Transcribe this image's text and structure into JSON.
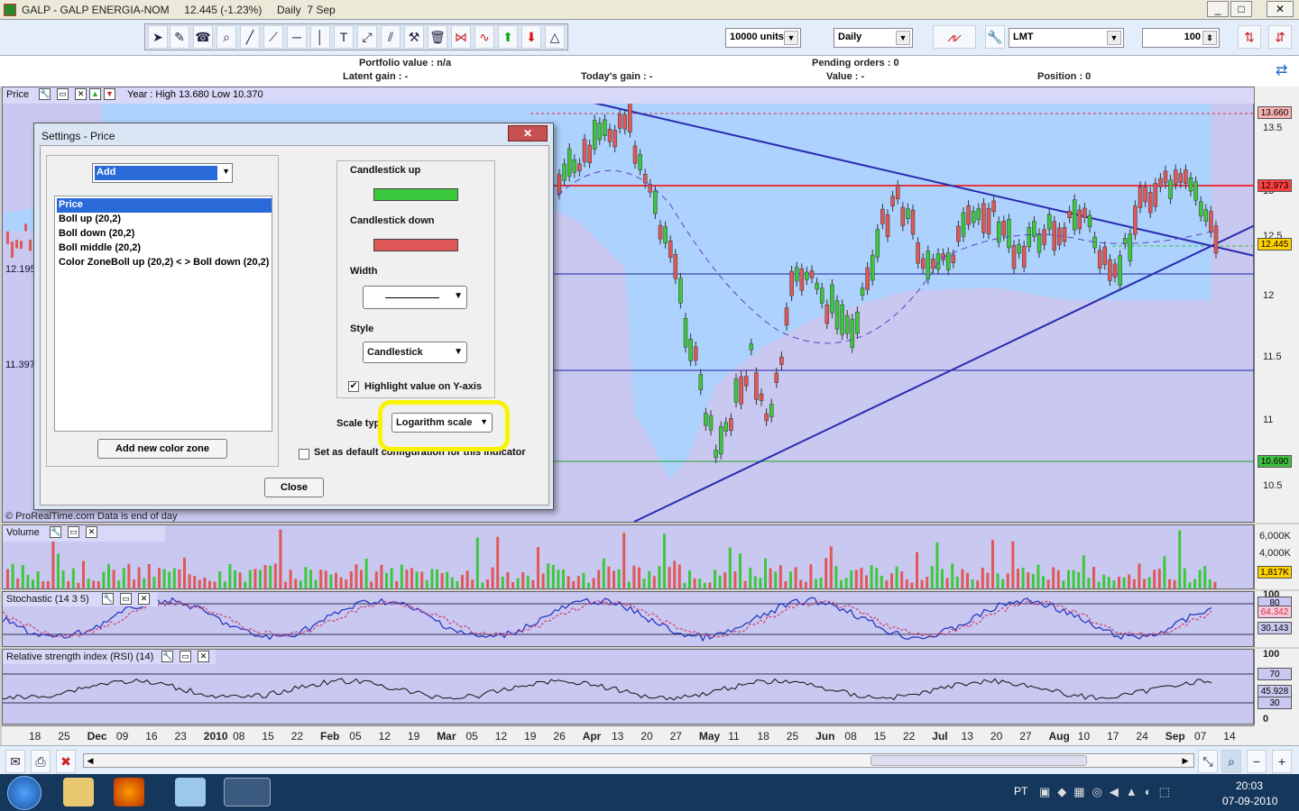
{
  "window": {
    "title": "GALP - GALP ENERGIA-NOM     12.445 (-1.23%)     Daily  7 Sep",
    "min": "_",
    "max": "□",
    "close": "✕"
  },
  "toolbar": {
    "units": "10000 units",
    "period": "Daily",
    "order_type": "LMT",
    "quantity": "100"
  },
  "portfolio": {
    "value": "Portfolio value : n/a",
    "latent": "Latent gain : -",
    "today": "Today's gain : -",
    "pending": "Pending orders : 0",
    "value2": "Value : -",
    "position": "Position : 0"
  },
  "price_panel": {
    "title": "Price",
    "year_info": "Year : High 13.680 Low 10.370",
    "left_val1": "12.195",
    "left_val2": "11.397",
    "credit": "© ProRealTime.com  Data is end of day",
    "y_labels": [
      "13.5",
      "13",
      "12.5",
      "12",
      "11.5",
      "11",
      "10.5"
    ],
    "tags": [
      {
        "v": "13.660",
        "c": "#f8b0b0"
      },
      {
        "v": "12.973",
        "c": "#ff4040"
      },
      {
        "v": "12.445",
        "c": "#ffd000"
      },
      {
        "v": "10.690",
        "c": "#40c040"
      }
    ]
  },
  "volume_panel": {
    "title": "Volume",
    "y_labels": [
      "6,000K",
      "4,000K"
    ],
    "tag": "1,817K"
  },
  "stoch_panel": {
    "title": "Stochastic (14 3 5)",
    "y_top": "100",
    "tags": [
      "80",
      "64.342",
      "30.143"
    ]
  },
  "rsi_panel": {
    "title": "Relative strength index (RSI) (14)",
    "y_labels": [
      "100",
      "0"
    ],
    "tags": [
      "70",
      "45.928",
      "30"
    ]
  },
  "xaxis": [
    {
      "t": "18",
      "b": false
    },
    {
      "t": "25",
      "b": false
    },
    {
      "t": "Dec",
      "b": true
    },
    {
      "t": "09",
      "b": false
    },
    {
      "t": "16",
      "b": false
    },
    {
      "t": "23",
      "b": false
    },
    {
      "t": "2010",
      "b": true
    },
    {
      "t": "08",
      "b": false
    },
    {
      "t": "15",
      "b": false
    },
    {
      "t": "22",
      "b": false
    },
    {
      "t": "Feb",
      "b": true
    },
    {
      "t": "05",
      "b": false
    },
    {
      "t": "12",
      "b": false
    },
    {
      "t": "19",
      "b": false
    },
    {
      "t": "Mar",
      "b": true
    },
    {
      "t": "05",
      "b": false
    },
    {
      "t": "12",
      "b": false
    },
    {
      "t": "19",
      "b": false
    },
    {
      "t": "26",
      "b": false
    },
    {
      "t": "Apr",
      "b": true
    },
    {
      "t": "13",
      "b": false
    },
    {
      "t": "20",
      "b": false
    },
    {
      "t": "27",
      "b": false
    },
    {
      "t": "May",
      "b": true
    },
    {
      "t": "11",
      "b": false
    },
    {
      "t": "18",
      "b": false
    },
    {
      "t": "25",
      "b": false
    },
    {
      "t": "Jun",
      "b": true
    },
    {
      "t": "08",
      "b": false
    },
    {
      "t": "15",
      "b": false
    },
    {
      "t": "22",
      "b": false
    },
    {
      "t": "Jul",
      "b": true
    },
    {
      "t": "13",
      "b": false
    },
    {
      "t": "20",
      "b": false
    },
    {
      "t": "27",
      "b": false
    },
    {
      "t": "Aug",
      "b": true
    },
    {
      "t": "10",
      "b": false
    },
    {
      "t": "17",
      "b": false
    },
    {
      "t": "24",
      "b": false
    },
    {
      "t": "Sep",
      "b": true
    },
    {
      "t": "07",
      "b": false
    },
    {
      "t": "14",
      "b": false
    }
  ],
  "dialog": {
    "title": "Settings - Price",
    "close": "✕",
    "add_label": "Add",
    "list": [
      "Price",
      "Boll up (20,2)",
      "Boll down (20,2)",
      "Boll middle (20,2)",
      "Color ZoneBoll up (20,2) < > Boll down (20,2)"
    ],
    "add_zone": "Add new color zone",
    "candle_up": "Candlestick up",
    "candle_down": "Candlestick down",
    "width": "Width",
    "style": "Style",
    "style_value": "Candlestick",
    "highlight": "Highlight value on Y-axis",
    "scale_type": "Scale typ",
    "scale_value": "Logarithm scale",
    "default_cfg": "Set as default configuration for this indicator",
    "close_btn": "Close",
    "up_color": "#3cc83c",
    "down_color": "#e05858"
  },
  "taskbar": {
    "lang": "PT",
    "time": "20:03",
    "date": "07-09-2010"
  }
}
